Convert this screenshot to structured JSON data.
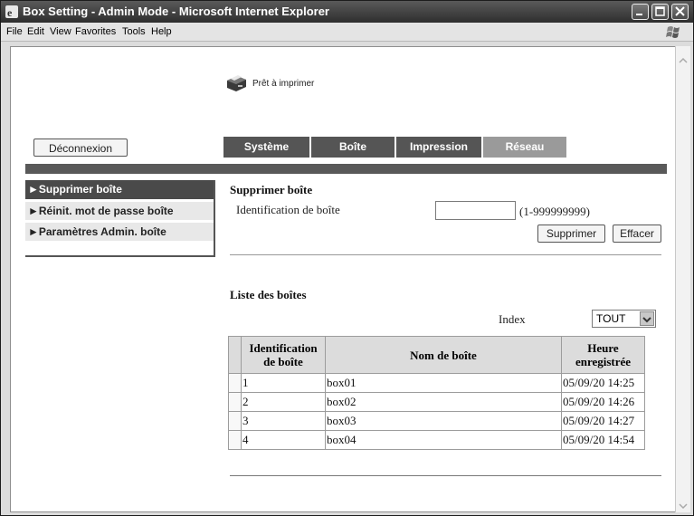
{
  "window": {
    "title": "Box Setting - Admin Mode - Microsoft Internet Explorer"
  },
  "menu": [
    {
      "label": "File"
    },
    {
      "label": "Edit"
    },
    {
      "label": "View"
    },
    {
      "label": "Favorites"
    },
    {
      "label": "Tools"
    },
    {
      "label": "Help"
    }
  ],
  "status": {
    "text": "Prêt à imprimer",
    "icon": "printer-icon"
  },
  "logout_label": "Déconnexion",
  "tabs": [
    {
      "label": "Système",
      "active": false
    },
    {
      "label": "Boîte",
      "active": false
    },
    {
      "label": "Impression",
      "active": false
    },
    {
      "label": "Réseau",
      "active": true
    }
  ],
  "sidebar": {
    "items": [
      {
        "label": "►Supprimer boîte",
        "selected": true
      },
      {
        "label": "►Réinit. mot de passe boîte",
        "selected": false
      },
      {
        "label": "►Paramètres Admin. boîte",
        "selected": false
      }
    ]
  },
  "delete_section": {
    "title": "Supprimer boîte",
    "field_label": "Identification de boîte",
    "field_value": "",
    "range_hint": "(1-999999999)",
    "delete_button": "Supprimer",
    "clear_button": "Effacer"
  },
  "list_section": {
    "title": "Liste des boîtes",
    "index_label": "Index",
    "index_value": "TOUT",
    "headers": {
      "id": "Identification de boîte",
      "name": "Nom de boîte",
      "time": "Heure enregistrée"
    },
    "rows": [
      {
        "id": "1",
        "name": "box01",
        "time": "05/09/20 14:25"
      },
      {
        "id": "2",
        "name": "box02",
        "time": "05/09/20 14:26"
      },
      {
        "id": "3",
        "name": "box03",
        "time": "05/09/20 14:27"
      },
      {
        "id": "4",
        "name": "box04",
        "time": "05/09/20 14:54"
      }
    ]
  },
  "colors": {
    "titlebar": "#3d3d3d",
    "tab_bg": "#555555",
    "tab_active": "#9a9a9a",
    "sidebar_selected": "#4a4a4a"
  }
}
